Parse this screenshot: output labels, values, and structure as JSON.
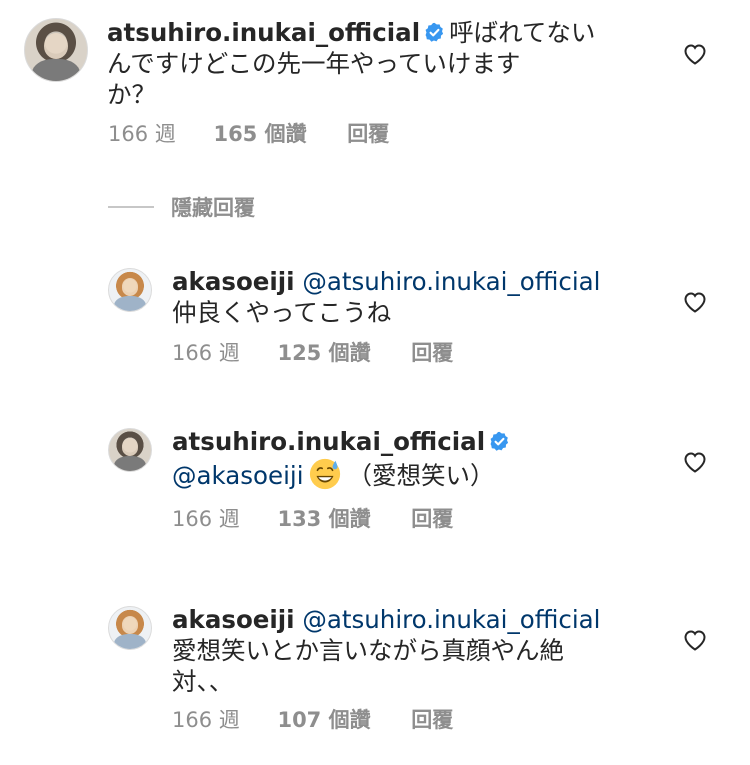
{
  "comments": [
    {
      "username": "atsuhiro.inukai_official",
      "verified": true,
      "text_line1": "呼ばれてない",
      "text_line2": "んですけどこの先一年やっていけます",
      "text_line3": "か？",
      "time": "166 週",
      "likes": "165 個讚",
      "reply_label": "回覆"
    },
    {
      "username": "akasoeiji",
      "mention": "@atsuhiro.inukai_official",
      "text_line1": "仲良くやってこうね",
      "time": "166 週",
      "likes": "125 個讚",
      "reply_label": "回覆"
    },
    {
      "username": "atsuhiro.inukai_official",
      "verified": true,
      "mention": "@akasoeiji",
      "emoji": "sweat-smile-emoji",
      "text_after_emoji": "（愛想笑い）",
      "time": "166 週",
      "likes": "133 個讚",
      "reply_label": "回覆"
    },
    {
      "username": "akasoeiji",
      "mention": "@atsuhiro.inukai_official",
      "text_line1": "愛想笑いとか言いながら真顔やん絶",
      "text_line2": "対、、",
      "time": "166 週",
      "likes": "107 個讚",
      "reply_label": "回覆"
    }
  ],
  "hide_replies_label": "隱藏回覆",
  "colors": {
    "text": "#262626",
    "secondary": "#8e8e8e",
    "mention": "#00376b",
    "verified": "#3897f0"
  },
  "icons": {
    "like": "heart-outline-icon",
    "verified": "verified-badge-icon"
  }
}
